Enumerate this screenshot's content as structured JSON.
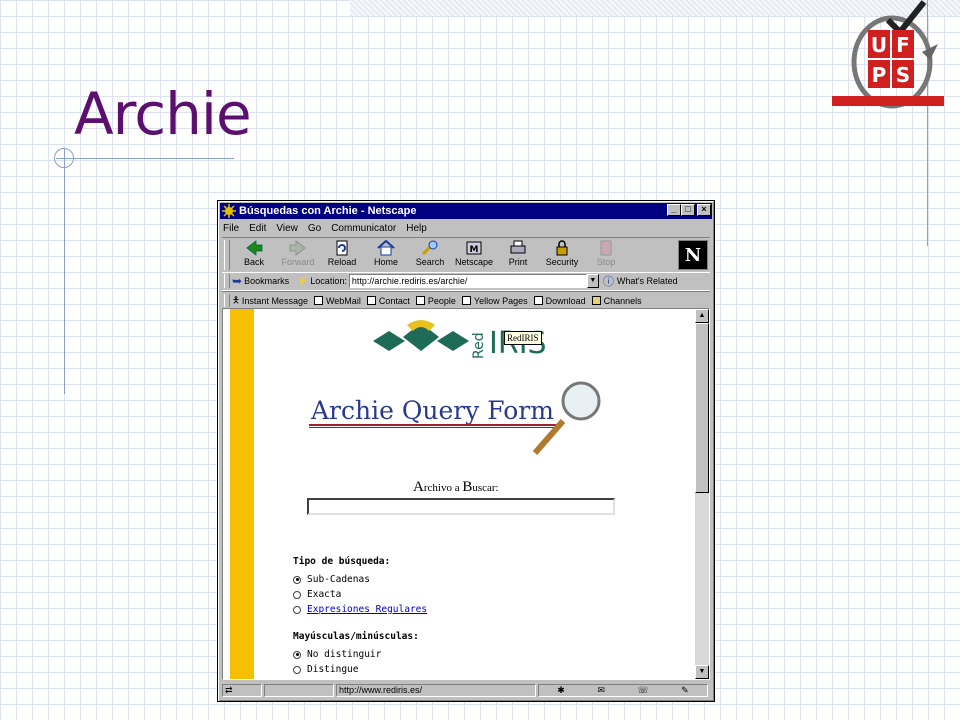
{
  "slide": {
    "title": "Archie",
    "logo_text": "UF PS"
  },
  "browser": {
    "title": "Búsquedas con Archie - Netscape",
    "window_buttons": [
      "_",
      "□",
      "×"
    ],
    "menu": [
      "File",
      "Edit",
      "View",
      "Go",
      "Communicator",
      "Help"
    ],
    "toolbar": {
      "back": "Back",
      "forward": "Forward",
      "reload": "Reload",
      "home": "Home",
      "search": "Search",
      "netscape": "Netscape",
      "print": "Print",
      "security": "Security",
      "stop": "Stop"
    },
    "location": {
      "bookmarks": "Bookmarks",
      "label": "Location:",
      "url": "http://archie.rediris.es/archie/",
      "whats_related": "What's Related"
    },
    "personal_toolbar": [
      "Instant Message",
      "WebMail",
      "Contact",
      "People",
      "Yellow Pages",
      "Download",
      "Channels"
    ],
    "ns_logo": "N",
    "status_url": "http://www.rediris.es/"
  },
  "page": {
    "rediris_tooltip": "RedIRIS",
    "rediris_red": "Red",
    "rediris_iris": "IRIS",
    "banner_title": "Archie Query Form",
    "search_label": {
      "cap_a": "A",
      "part1": "rchivo a ",
      "cap_b": "B",
      "part2": "uscar:"
    },
    "tipo": {
      "heading": "Tipo de búsqueda:",
      "options": [
        "Sub-Cadenas",
        "Exacta",
        "Expresiones Regulares"
      ],
      "selected": 0
    },
    "mayus": {
      "heading": "Mayúsculas/minúsculas:",
      "options": [
        "No distinguir",
        "Distingue"
      ],
      "selected": 0
    }
  },
  "colors": {
    "title": "#5b0f6e",
    "titlebar": "#000080",
    "page_bar": "#f6c000",
    "link": "#0000cc"
  }
}
